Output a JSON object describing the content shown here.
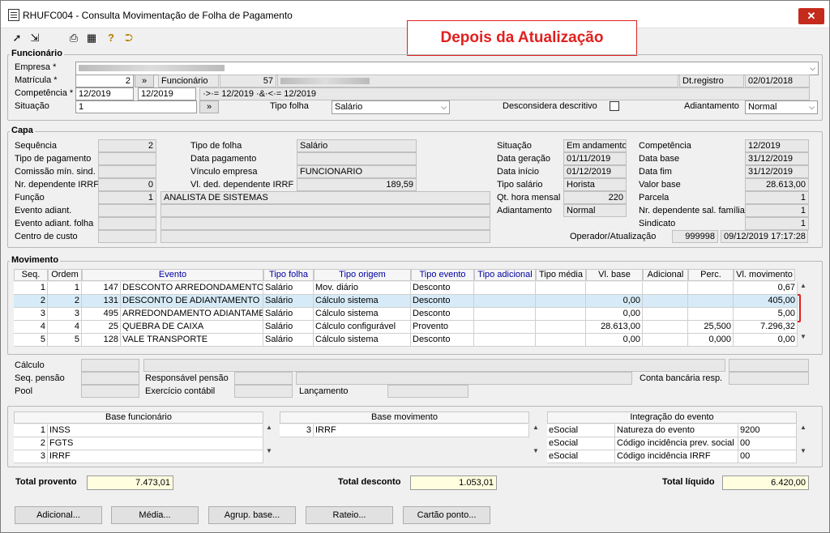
{
  "window": {
    "title": "RHUFC004 - Consulta Movimentação de Folha de Pagamento",
    "close": "✕"
  },
  "banner": "Depois da Atualização",
  "funcionario": {
    "title": "Funcionário",
    "empresa_label": "Empresa *",
    "matricula_label": "Matrícula *",
    "matricula": "2",
    "funcionario_label": "Funcionário",
    "funcionario_code": "57",
    "dtregistro_label": "Dt.registro",
    "dtregistro": "02/01/2018",
    "competencia_label": "Competência *",
    "comp_from": "12/2019",
    "comp_to": "12/2019",
    "comp_expr": "·>·= 12/2019 ·&·<·= 12/2019",
    "situacao_label": "Situação",
    "situacao": "1",
    "tipofolha_label": "Tipo folha",
    "tipofolha": "Salário",
    "desconsidera_label": "Desconsidera descritivo",
    "adiantamento_label": "Adiantamento",
    "adiantamento": "Normal",
    "lookup": "»"
  },
  "capa": {
    "title": "Capa",
    "left": [
      {
        "l": "Sequência",
        "v": "2"
      },
      {
        "l": "Tipo de pagamento",
        "v": ""
      },
      {
        "l": "Comissão mín. sind.",
        "v": ""
      },
      {
        "l": "Nr. dependente IRRF",
        "v": "0"
      },
      {
        "l": "Função",
        "v": "1"
      },
      {
        "l": "Evento adiant.",
        "v": ""
      },
      {
        "l": "Evento adiant. folha",
        "v": ""
      },
      {
        "l": "Centro de custo",
        "v": ""
      }
    ],
    "mid": [
      {
        "l": "Tipo de folha",
        "v": "Salário"
      },
      {
        "l": "Data pagamento",
        "v": ""
      },
      {
        "l": "Vínculo empresa",
        "v": "FUNCIONARIO"
      },
      {
        "l": "Vl. ded. dependente IRRF",
        "v": "189,59"
      }
    ],
    "funcao_desc": "ANALISTA DE SISTEMAS",
    "r1": [
      {
        "l": "Situação",
        "v": "Em andamento"
      },
      {
        "l": "Data geração",
        "v": "01/11/2019"
      },
      {
        "l": "Data início",
        "v": "01/12/2019"
      },
      {
        "l": "Tipo salário",
        "v": "Horista"
      },
      {
        "l": "Qt. hora mensal",
        "v": "220"
      },
      {
        "l": "Adiantamento",
        "v": "Normal"
      }
    ],
    "r2": [
      {
        "l": "Competência",
        "v": "12/2019"
      },
      {
        "l": "Data base",
        "v": "31/12/2019"
      },
      {
        "l": "Data fim",
        "v": "31/12/2019"
      },
      {
        "l": "Valor base",
        "v": "28.613,00"
      },
      {
        "l": "Parcela",
        "v": "1"
      },
      {
        "l": "Nr. dependente sal. família",
        "v": "1"
      },
      {
        "l": "Sindicato",
        "v": "1"
      }
    ],
    "operador_label": "Operador/Atualização",
    "operador": "999998",
    "atualizacao": "09/12/2019 17:17:28"
  },
  "movimento": {
    "title": "Movimento",
    "headers": [
      "Seq.",
      "Ordem",
      "Evento",
      "Tipo folha",
      "Tipo origem",
      "Tipo evento",
      "Tipo adicional",
      "Tipo média",
      "Vl. base",
      "Adicional",
      "Perc.",
      "Vl. movimento"
    ],
    "rows": [
      [
        "1",
        "1",
        "147",
        "DESCONTO ARREDONDAMENTO SA",
        "Salário",
        "Mov. diário",
        "Desconto",
        "",
        "",
        "",
        "",
        "",
        "0,67"
      ],
      [
        "2",
        "2",
        "131",
        "DESCONTO DE ADIANTAMENTO DE",
        "Salário",
        "Cálculo sistema",
        "Desconto",
        "",
        "",
        "0,00",
        "",
        "",
        "405,00"
      ],
      [
        "3",
        "3",
        "495",
        "ARREDONDAMENTO ADIANTAMENT",
        "Salário",
        "Cálculo sistema",
        "Desconto",
        "",
        "",
        "0,00",
        "",
        "",
        "5,00"
      ],
      [
        "4",
        "4",
        "25",
        "QUEBRA DE CAIXA",
        "Salário",
        "Cálculo configurável",
        "Provento",
        "",
        "",
        "28.613,00",
        "",
        "25,500",
        "7.296,32"
      ],
      [
        "5",
        "5",
        "128",
        "VALE TRANSPORTE",
        "Salário",
        "Cálculo sistema",
        "Desconto",
        "",
        "",
        "0,00",
        "",
        "0,000",
        "0,00"
      ]
    ]
  },
  "detalhe": {
    "calculo": "Cálculo",
    "seqpensao": "Seq. pensão",
    "pool": "Pool",
    "resp_pensao": "Responsável pensão",
    "exercicio": "Exercício contábil",
    "lancamento": "Lançamento",
    "conta_bancaria": "Conta bancária resp."
  },
  "base_func": {
    "title": "Base funcionário",
    "rows": [
      [
        "1",
        "INSS"
      ],
      [
        "2",
        "FGTS"
      ],
      [
        "3",
        "IRRF"
      ]
    ]
  },
  "base_mov": {
    "title": "Base movimento",
    "rows": [
      [
        "3",
        "IRRF"
      ]
    ]
  },
  "integracao": {
    "title": "Integração do evento",
    "rows": [
      [
        "eSocial",
        "Natureza do evento",
        "9200"
      ],
      [
        "eSocial",
        "Código incidência prev. social",
        "00"
      ],
      [
        "eSocial",
        "Código incidência IRRF",
        "00"
      ]
    ]
  },
  "totais": {
    "provento_label": "Total provento",
    "provento": "7.473,01",
    "desconto_label": "Total desconto",
    "desconto": "1.053,01",
    "liquido_label": "Total líquido",
    "liquido": "6.420,00"
  },
  "buttons": [
    "Adicional...",
    "Média...",
    "Agrup. base...",
    "Rateio...",
    "Cartão ponto..."
  ]
}
